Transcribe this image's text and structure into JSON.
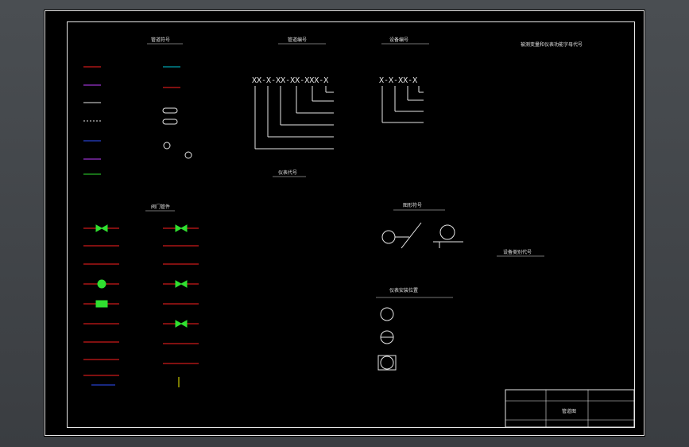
{
  "colors": {
    "red": "#ff2020",
    "magenta": "#c040ff",
    "cyan": "#00c8d8",
    "blue": "#3050ff",
    "green": "#30e030",
    "white": "#e6e6e6",
    "yellow": "#f0f000"
  },
  "drawing": {
    "code_string_1": "XX-X-XX-XX-XXX-X",
    "code_string_2": "X-X-XX-X",
    "title_block_big_label": "管道图",
    "section_titles": {
      "line_symbols": "管道符号",
      "line_numbering": "管道编号",
      "equipment_numbering": "设备编号",
      "valves": "阀门管件",
      "instruments": "仪表代号",
      "graphic_symbols": "图形符号",
      "mounting": "仪表安装位置",
      "functions": "被测变量和仪表功能字母代号",
      "equipment_codes": "设备类别代号"
    }
  },
  "icons": [
    "pipe-line-icon",
    "gate-valve-icon",
    "globe-valve-icon",
    "check-valve-icon",
    "ball-valve-icon",
    "instrument-bubble-icon"
  ]
}
